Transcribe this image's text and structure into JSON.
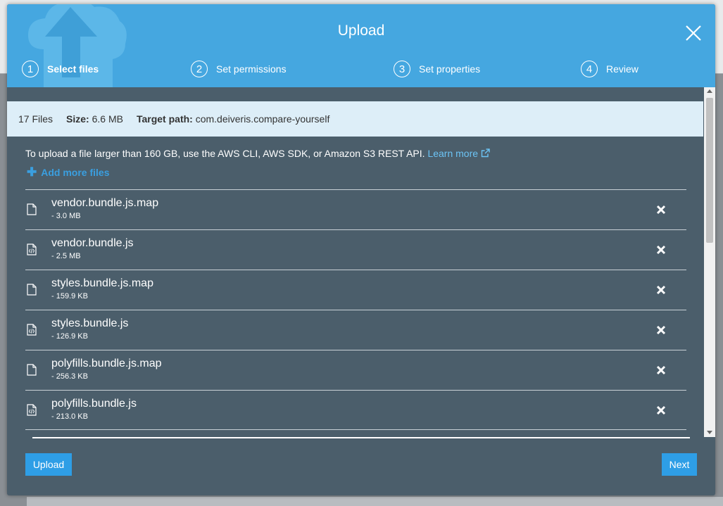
{
  "modal": {
    "title": "Upload",
    "steps": [
      {
        "num": "1",
        "label": "Select files",
        "active": true
      },
      {
        "num": "2",
        "label": "Set permissions",
        "active": false
      },
      {
        "num": "3",
        "label": "Set properties",
        "active": false
      },
      {
        "num": "4",
        "label": "Review",
        "active": false
      }
    ]
  },
  "summary": {
    "files": "17 Files",
    "size_label": "Size:",
    "size_value": "6.6 MB",
    "path_label": "Target path:",
    "path_value": "com.deiveris.compare-yourself"
  },
  "notice": {
    "text": "To upload a file larger than 160 GB, use the AWS CLI, AWS SDK, or Amazon S3 REST API.",
    "link": "Learn more"
  },
  "add_more": "Add more files",
  "files": [
    {
      "name": "vendor.bundle.js.map",
      "size": "- 3.0 MB",
      "icon": "file-icon"
    },
    {
      "name": "vendor.bundle.js",
      "size": "- 2.5 MB",
      "icon": "code-file-icon"
    },
    {
      "name": "styles.bundle.js.map",
      "size": "- 159.9 KB",
      "icon": "file-icon"
    },
    {
      "name": "styles.bundle.js",
      "size": "- 126.9 KB",
      "icon": "code-file-icon"
    },
    {
      "name": "polyfills.bundle.js.map",
      "size": "- 256.3 KB",
      "icon": "file-icon"
    },
    {
      "name": "polyfills.bundle.js",
      "size": "- 213.0 KB",
      "icon": "code-file-icon"
    }
  ],
  "buttons": {
    "upload": "Upload",
    "next": "Next"
  },
  "colors": {
    "header": "#45a7e0",
    "body": "#4b5e6b",
    "info_bar": "#ddeef8",
    "accent": "#2e9ee6",
    "link": "#6cc4f5"
  }
}
